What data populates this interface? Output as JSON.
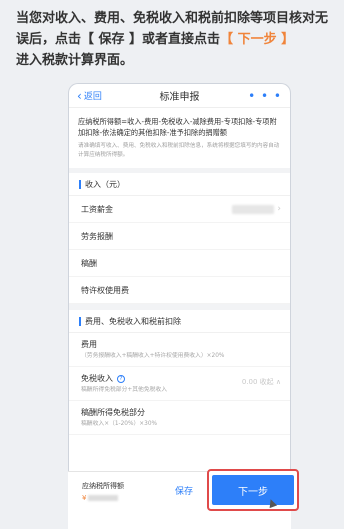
{
  "instruction": {
    "part1": "当您对收入、费用、免税收入和税前扣除等项目核对无误后，点击【 保存 】或者直接点击",
    "highlight": "【 下一步 】",
    "part2": "进入税款计算界面。"
  },
  "nav": {
    "back_label": "返回",
    "title": "标准申报",
    "more": "• • •"
  },
  "formula": "应纳税所得额=收入-费用-免税收入-减除费用-专项扣除-专项附加扣除-依法确定的其他扣除-准予扣除的捐赠额",
  "note": "请准确填写收入、费用、免税收入和税前扣除信息，系统将根据您填写的内容自动计算应纳税所得额。",
  "income_section": {
    "title": "收入（元）",
    "rows": [
      {
        "label": "工资薪金"
      },
      {
        "label": "劳务报酬"
      },
      {
        "label": "稿酬"
      },
      {
        "label": "特许权使用费"
      }
    ]
  },
  "deduction_section": {
    "title": "费用、免税收入和税前扣除",
    "expense": {
      "label": "费用",
      "sub": "（劳务报酬收入+稿酬收入+特许权使用费收入）×20%"
    },
    "exempt": {
      "label": "免税收入",
      "value": "0.00 收起 ∧",
      "sub": "稿酬所得免税部分+其他免税收入"
    },
    "royalty_exempt": {
      "label": "稿酬所得免税部分",
      "sub": "稿酬收入×（1-20%）×30%"
    }
  },
  "bottom": {
    "taxable_label": "应纳税所得额",
    "currency": "¥",
    "save_label": "保存",
    "next_label": "下一步"
  },
  "colors": {
    "accent": "#2d7ff9",
    "highlight": "#f0843a",
    "callout": "#e04a4a"
  }
}
